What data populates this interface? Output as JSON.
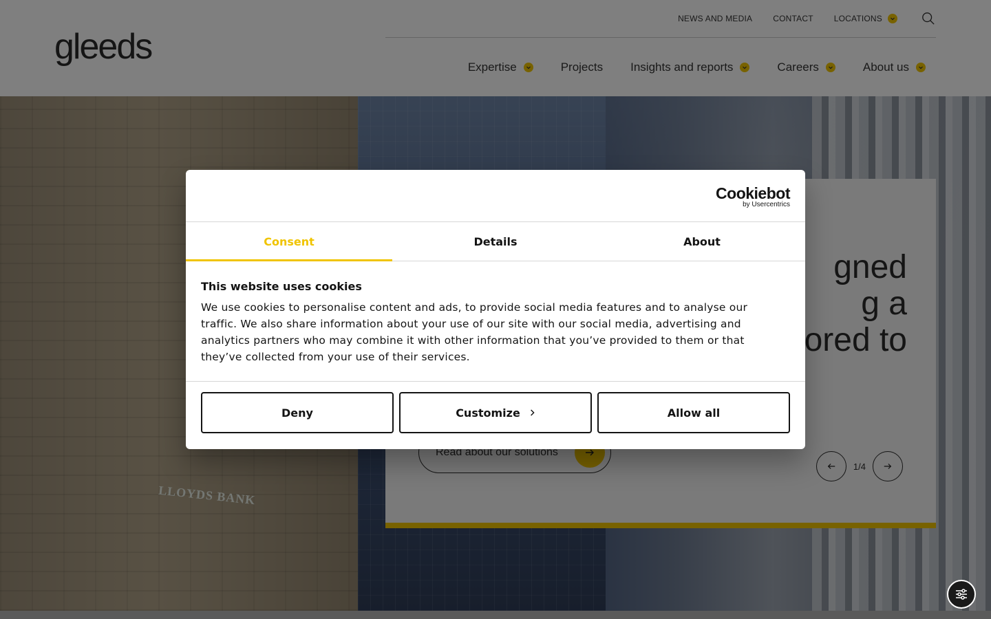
{
  "header": {
    "logo": "gleeds",
    "top_nav": [
      {
        "label": "NEWS AND MEDIA"
      },
      {
        "label": "CONTACT"
      },
      {
        "label": "LOCATIONS",
        "has_dropdown": true
      }
    ],
    "main_nav": [
      {
        "label": "Expertise",
        "has_dropdown": true
      },
      {
        "label": "Projects",
        "has_dropdown": false
      },
      {
        "label": "Insights and reports",
        "has_dropdown": true
      },
      {
        "label": "Careers",
        "has_dropdown": true
      },
      {
        "label": "About us",
        "has_dropdown": true
      }
    ]
  },
  "hero": {
    "sign_text": "LLOYDS BANK",
    "headline": "gned\ng a\nored to",
    "cta_label": "Read about our solutions",
    "pager": "1/4"
  },
  "cookie_dialog": {
    "brand_name": "Cookiebot",
    "brand_sub": "by Usercentrics",
    "tabs": [
      {
        "label": "Consent",
        "active": true
      },
      {
        "label": "Details",
        "active": false
      },
      {
        "label": "About",
        "active": false
      }
    ],
    "title": "This website uses cookies",
    "body": "We use cookies to personalise content and ads, to provide social media features and to analyse our traffic. We also share information about your use of our site with our social media, advertising and analytics partners who may combine it with other information that you’ve provided to them or that they’ve collected from your use of their services.",
    "buttons": {
      "deny": "Deny",
      "customize": "Customize",
      "allow_all": "Allow all"
    }
  },
  "colors": {
    "accent": "#f0c400",
    "text": "#141414",
    "overlay": "rgba(0,0,0,0.5)"
  },
  "icons": {
    "search": "search-icon",
    "dropdown": "chevron-down-icon",
    "arrow_right": "arrow-right-icon",
    "arrow_left": "arrow-left-icon",
    "settings": "sliders-icon"
  }
}
